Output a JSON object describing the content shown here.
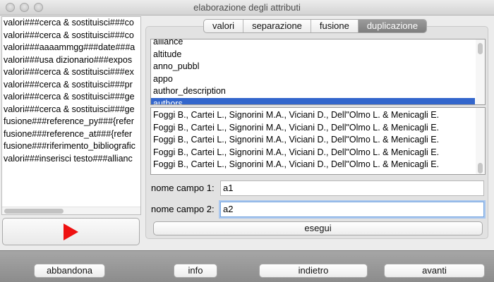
{
  "window": {
    "title": "elaborazione degli attributi"
  },
  "left_list": {
    "items": [
      "valori###cerca & sostituisci###co",
      "valori###cerca & sostituisci###co",
      "valori###aaaammgg###date###a",
      "valori###usa dizionario###expos",
      "valori###cerca & sostituisci###ex",
      "valori###cerca & sostituisci###pr",
      "valori###cerca & sostituisci###ge",
      "valori###cerca & sostituisci###ge",
      "fusione###reference_py###{refer",
      "fusione###reference_at###{refer",
      "fusione###riferimento_bibliografic",
      "valori###inserisci testo###allianc"
    ]
  },
  "tabs": [
    {
      "label": "valori",
      "active": false
    },
    {
      "label": "separazione",
      "active": false
    },
    {
      "label": "fusione",
      "active": false
    },
    {
      "label": "duplicazione",
      "active": true
    }
  ],
  "attributes": {
    "items": [
      "alliance",
      "altitude",
      "anno_pubbl",
      "appo",
      "author_description",
      "authors"
    ],
    "selected": "authors"
  },
  "values": {
    "items": [
      "Foggi B., Cartei L., Signorini M.A., Viciani D., Dell\"Olmo L. & Menicagli E.",
      "Foggi B., Cartei L., Signorini M.A., Viciani D., Dell\"Olmo L. & Menicagli E.",
      "Foggi B., Cartei L., Signorini M.A., Viciani D., Dell\"Olmo L. & Menicagli E.",
      "Foggi B., Cartei L., Signorini M.A., Viciani D., Dell\"Olmo L. & Menicagli E.",
      "Foggi B., Cartei L., Signorini M.A., Viciani D., Dell\"Olmo L. & Menicagli E."
    ]
  },
  "fields": {
    "field1_label": "nome campo 1:",
    "field1_value": "a1",
    "field2_label": "nome campo 2:",
    "field2_value": "a2"
  },
  "buttons": {
    "execute": "esegui",
    "abandon": "abbandona",
    "info": "info",
    "back": "indietro",
    "forward": "avanti"
  },
  "colors": {
    "selection": "#3366cc",
    "play": "#ee1111"
  }
}
